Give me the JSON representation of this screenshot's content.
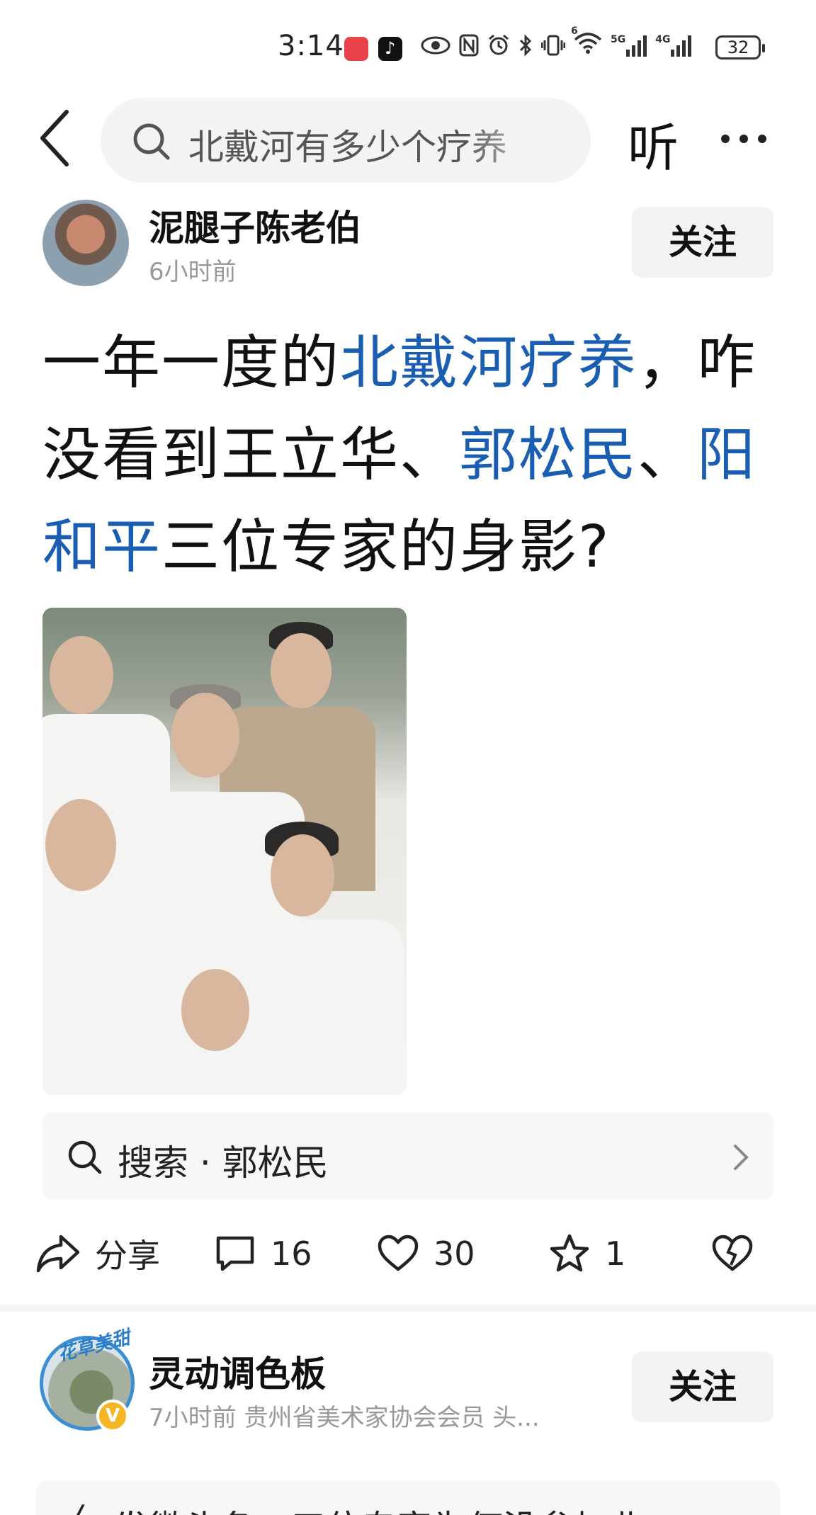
{
  "status_bar": {
    "time": "3:14",
    "network_5g": "5G",
    "network_4g": "4G",
    "wifi_label": "6",
    "battery": "32"
  },
  "nav": {
    "search_query": "北戴河有多少个疗养",
    "listen_label": "听"
  },
  "post": {
    "author_name": "泥腿子陈老伯",
    "time": "6小时前",
    "follow_label": "关注",
    "text_parts": {
      "p1": "一年一度的",
      "link1": "北戴河疗养",
      "p2": "，咋没看到王立华、",
      "link2": "郭松民",
      "p3": "、",
      "link3": "阳和平",
      "p4": "三位专家的身影?"
    },
    "search_suggestion": "搜索 · 郭松民",
    "actions": {
      "share_label": "分享",
      "comments": "16",
      "likes": "30",
      "favorites": "1"
    }
  },
  "next_post": {
    "avatar_tag": "花草美甜",
    "verified_mark": "V",
    "author_name": "灵动调色板",
    "meta": "7小时前  贵州省美术家协会会员 头...",
    "follow_label": "关注",
    "preview_text": "发微头条，三位专家为何没参加北"
  },
  "colors": {
    "link": "#1a5eb3",
    "follow_bg": "#f2f3f5",
    "secondary_text": "#999999",
    "verified": "#f4b624"
  }
}
